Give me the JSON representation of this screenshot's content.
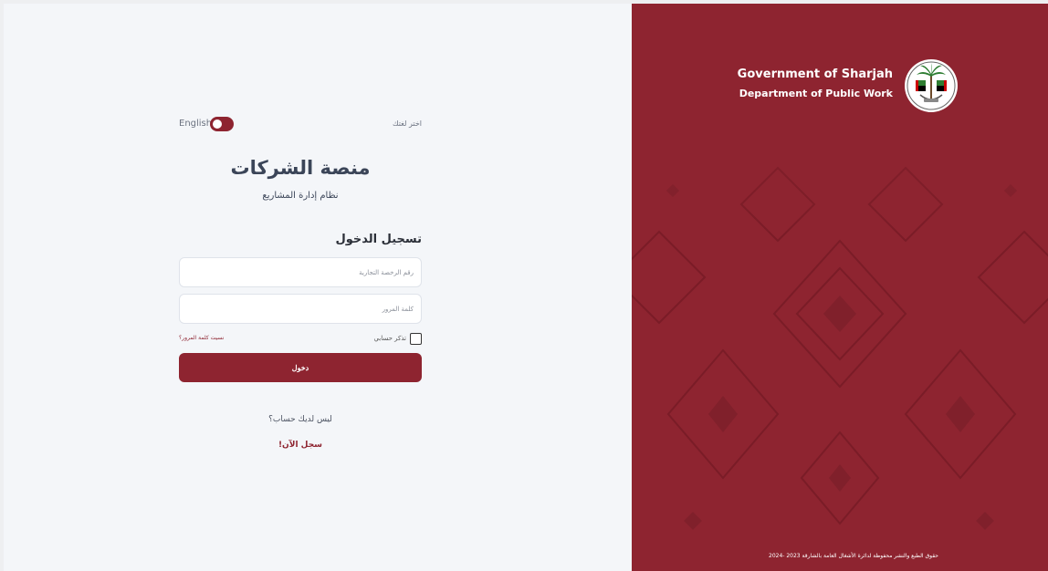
{
  "language": {
    "toggle_label": "English",
    "choose_label": "اختر لغتك"
  },
  "brand": {
    "platform_title": "منصة الشركات",
    "platform_subtitle": "نظام إدارة المشاريع"
  },
  "login": {
    "heading": "تسجيل الدخول",
    "license_placeholder": "رقم الرخصة التجارية",
    "password_placeholder": "كلمة المرور",
    "remember_label": "تذكر حسابي",
    "forgot_label": "نسيت كلمة المرور؟",
    "submit_label": "دخول",
    "no_account": "ليس لديك حساب؟",
    "register_label": "سجل الآن!"
  },
  "panel": {
    "gov_line1": "Government of Sharjah",
    "gov_line2": "Department of Public Work",
    "copyright": "حقوق الطبع والنشر محفوظة لدائرة الأشغال العامة بالشارقة 2023 -2024",
    "emblem_icon": "sharjah-emblem-icon",
    "accent_color": "#8e2430"
  }
}
